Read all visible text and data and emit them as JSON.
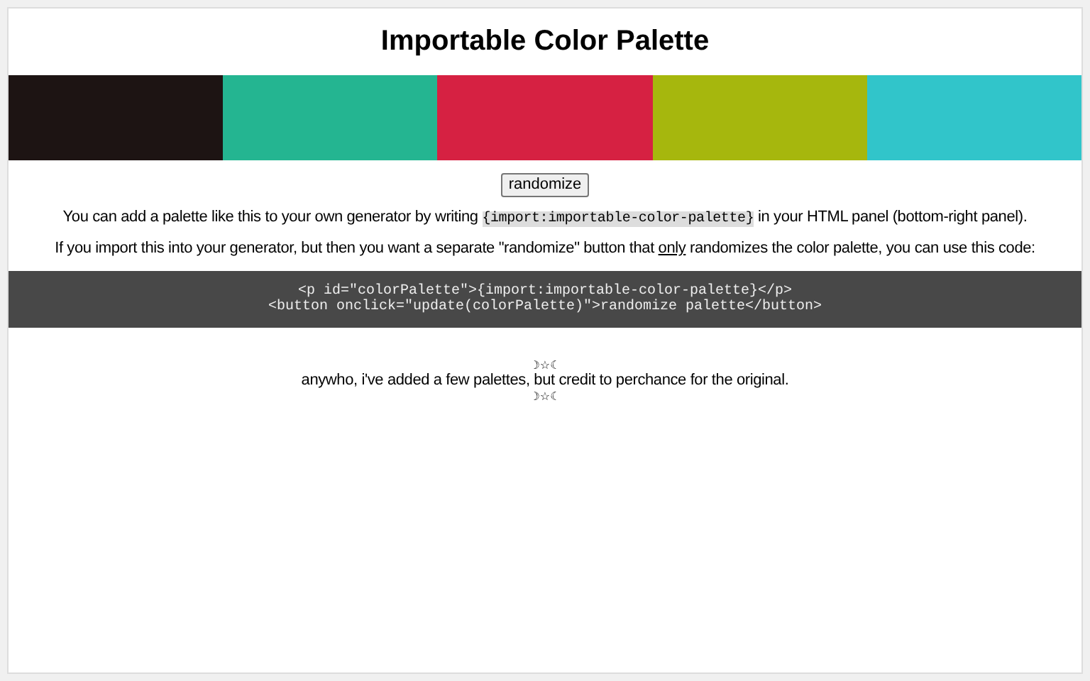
{
  "title": "Importable Color Palette",
  "swatches": [
    {
      "color": "#1d1413"
    },
    {
      "color": "#24b591"
    },
    {
      "color": "#d62142"
    },
    {
      "color": "#a6b70d"
    },
    {
      "color": "#31c5ca"
    }
  ],
  "randomize_button": "randomize",
  "intro": {
    "before": "You can add a palette like this to your own generator by writing ",
    "code": "{import:importable-color-palette}",
    "after": " in your HTML panel (bottom-right panel)."
  },
  "import_note": {
    "before": "If you import this into your generator, but then you want a separate \"randomize\" button that ",
    "underlined": "only",
    "after": " randomizes the color palette, you can use this code:"
  },
  "code_lines": [
    "<p id=\"colorPalette\">{import:importable-color-palette}</p>",
    "<button onclick=\"update(colorPalette)\">randomize palette</button>"
  ],
  "footer": {
    "ornament_top": "☽☆☾",
    "text": "anywho, i've added a few palettes, but credit to perchance for the original.",
    "ornament_bottom": "☽☆☾"
  }
}
